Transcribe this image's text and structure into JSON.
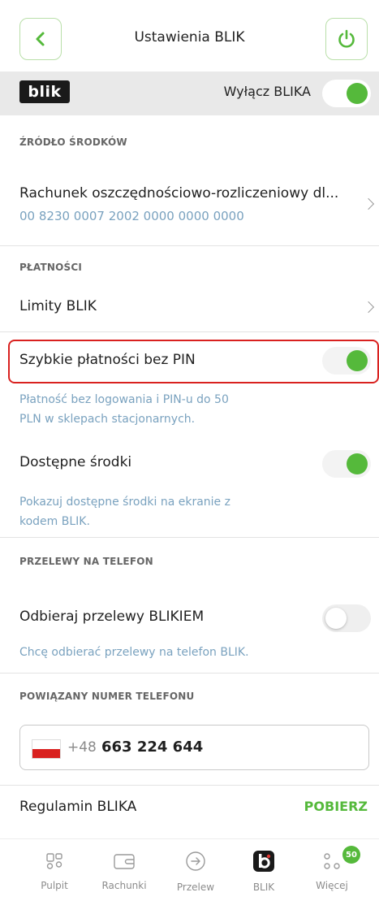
{
  "header": {
    "title": "Ustawienia BLIK",
    "back_icon": "chevron-left-icon",
    "power_icon": "power-icon",
    "accent": "#55b93b"
  },
  "blik_bar": {
    "logo_text": "blik",
    "label": "Wyłącz BLIKA",
    "toggle_on": true
  },
  "source": {
    "section_label": "ŹRÓDŁO ŚRODKÓW",
    "account_name": "Rachunek oszczędnościowo-rozliczeniowy dl...",
    "account_number": "00 8230 0007 2002 0000 0000 0000"
  },
  "payments": {
    "section_label": "PŁATNOŚCI",
    "limits_label": "Limity BLIK",
    "quick_label": "Szybkie płatności bez PIN",
    "quick_toggle_on": true,
    "quick_desc_line1": "Płatność bez logowania i PIN-u do 50",
    "quick_desc_line2": "PLN w sklepach stacjonarnych.",
    "funds_label": "Dostępne środki",
    "funds_toggle_on": true,
    "funds_desc_line1": "Pokazuj dostępne środki na ekranie z",
    "funds_desc_line2": "kodem BLIK."
  },
  "transfers": {
    "section_label": "PRZELEWY NA TELEFON",
    "receive_label": "Odbieraj przelewy BLIKIEM",
    "receive_toggle_on": false,
    "receive_desc": "Chcę odbierać przelewy na telefon BLIK."
  },
  "phone": {
    "section_label": "POWIĄZANY NUMER TELEFONU",
    "prefix": "+48",
    "number": "663 224 644"
  },
  "regulations": {
    "label": "Regulamin BLIKA",
    "action": "POBIERZ"
  },
  "tabbar": {
    "tabs": [
      {
        "label": "Pulpit",
        "icon": "dashboard-icon"
      },
      {
        "label": "Rachunki",
        "icon": "wallet-icon"
      },
      {
        "label": "Przelew",
        "icon": "arrow-right-circle-icon"
      },
      {
        "label": "BLIK",
        "icon": "blik-icon"
      },
      {
        "label": "Więcej",
        "icon": "more-icon"
      }
    ],
    "badge": "50"
  }
}
